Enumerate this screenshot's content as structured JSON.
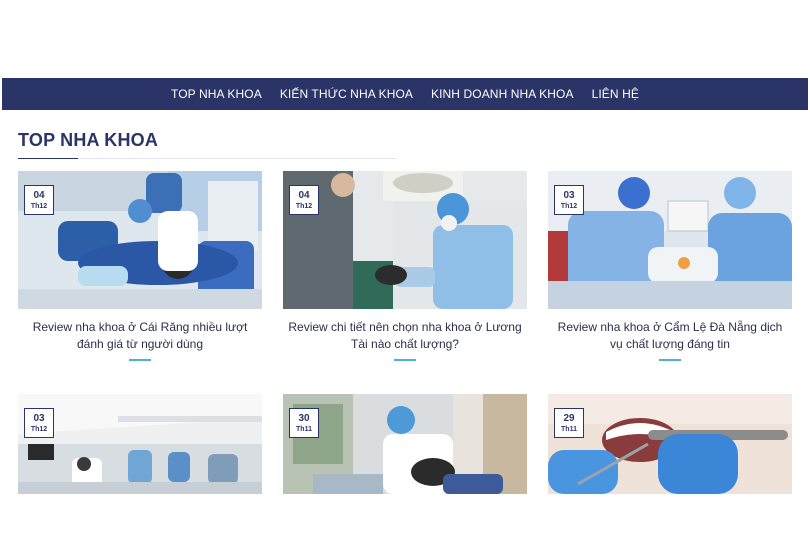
{
  "nav": {
    "items": [
      {
        "label": "TOP NHA KHOA"
      },
      {
        "label": "KIẾN THỨC NHA KHOA"
      },
      {
        "label": "KINH DOANH NHA KHOA"
      },
      {
        "label": "LIÊN HỆ"
      }
    ]
  },
  "section": {
    "title": "TOP NHA KHOA"
  },
  "posts": [
    {
      "day": "04",
      "month": "Th12",
      "title": "Review nha khoa ở Cái Răng nhiều lượt đánh giá từ người dùng"
    },
    {
      "day": "04",
      "month": "Th12",
      "title": "Review chi tiết nên chọn nha khoa ở Lương Tài nào chất lượng?"
    },
    {
      "day": "03",
      "month": "Th12",
      "title": "Review nha khoa ở Cẩm Lệ Đà Nẵng dịch vụ chất lượng đáng tin"
    },
    {
      "day": "03",
      "month": "Th12"
    },
    {
      "day": "30",
      "month": "Th11"
    },
    {
      "day": "29",
      "month": "Th11"
    }
  ],
  "colors": {
    "nav_bg": "#2b3467",
    "accent": "#4fb3c8"
  }
}
